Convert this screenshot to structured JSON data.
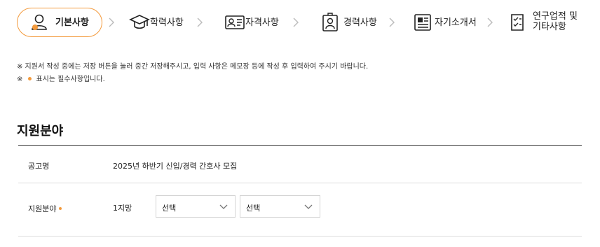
{
  "steps": [
    {
      "label": "기본사항",
      "icon": "person-icon",
      "active": true
    },
    {
      "label": "학력사항",
      "icon": "graduation-cap-icon",
      "active": false
    },
    {
      "label": "자격사항",
      "icon": "id-card-icon",
      "active": false
    },
    {
      "label": "경력사항",
      "icon": "badge-person-icon",
      "active": false
    },
    {
      "label": "자기소개서",
      "icon": "newspaper-icon",
      "active": false
    },
    {
      "label_line1": "연구업적 및",
      "label_line2": "기타사항",
      "icon": "checklist-icon",
      "active": false
    }
  ],
  "notices": {
    "line1": "※ 지원서 작성 중에는 저장 버튼을 눌러 중간 저장해주시고, 입력 사항은 메모장 등에 작성 후 입력하여 주시기 바랍니다.",
    "line2_prefix": "※",
    "line2_text": "표시는 필수사항입니다."
  },
  "section": {
    "title": "지원분야",
    "rows": [
      {
        "label": "공고명",
        "value": "2025년 하반기 신입/경력 간호사 모집"
      },
      {
        "label": "지원분야",
        "choice_label": "1지망",
        "selects": [
          "선택",
          "선택"
        ]
      }
    ]
  },
  "colors": {
    "accent": "#f39a3c",
    "rule": "#333333",
    "divider": "#dcdcdc"
  }
}
